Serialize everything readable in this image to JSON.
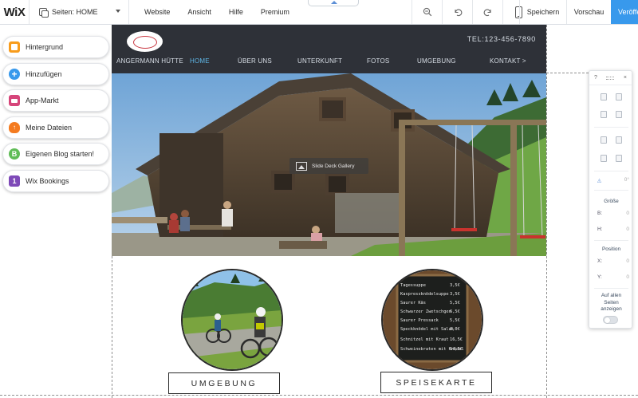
{
  "editor": {
    "logo": "WiX",
    "pages_selector": "Seiten: HOME",
    "menu": [
      "Website",
      "Ansicht",
      "Hilfe",
      "Premium"
    ],
    "save_label": "Speichern",
    "preview_label": "Vorschau",
    "publish_label": "Veröffentlichen",
    "accent_color": "#3899ec"
  },
  "left_panel": {
    "items": [
      {
        "label": "Hintergrund",
        "icon": "background-icon",
        "color": "#f89c1c"
      },
      {
        "label": "Hinzufügen",
        "icon": "add-icon",
        "color": "#3899ec"
      },
      {
        "label": "App-Markt",
        "icon": "app-market-icon",
        "color": "#d6457a"
      },
      {
        "label": "Meine Dateien",
        "icon": "cloud-upload-icon",
        "color": "#f47b20"
      },
      {
        "label": "Eigenen Blog starten!",
        "icon": "blog-icon",
        "color": "#60bc57"
      },
      {
        "label": "Wix Bookings",
        "icon": "calendar-icon",
        "color": "#7e4ab8"
      }
    ]
  },
  "site": {
    "phone": "TEL:123-456-7890",
    "nav": [
      "ANGERMANN HÜTTE",
      "HOME",
      "ÜBER UNS",
      "UNTERKUNFT",
      "FOTOS",
      "UMGEBUNG",
      "KONTAKT >"
    ],
    "active_nav": "HOME",
    "gallery_label": "Slide Deck Gallery",
    "section_buttons": [
      "UMGEBUNG",
      "SPEISEKARTE"
    ],
    "menu_board": {
      "items": [
        {
          "name": "Tagessuppe",
          "price": "3,5€"
        },
        {
          "name": "Kaspressknödelsuppe",
          "price": "3,5€"
        },
        {
          "name": "Saurer Käs",
          "price": "5,5€"
        },
        {
          "name": "Schwarzer Zwetschgen",
          "price": "6,5€"
        },
        {
          "name": "Saurer Pressack",
          "price": "5,5€"
        },
        {
          "name": "Speckknödel mit Salat",
          "price": "8,0€"
        },
        {
          "name": "Schnitzel mit Kraut",
          "price": "16,5€"
        },
        {
          "name": "Schweinebraten mit Knödel",
          "price": "14,5€"
        }
      ]
    }
  },
  "right_panel": {
    "help": "?",
    "close": "×",
    "rotation": "0°",
    "size_label": "Größe",
    "width_label": "B:",
    "width_value": "0",
    "height_label": "H:",
    "height_value": "0",
    "position_label": "Position",
    "x_label": "X:",
    "x_value": "0",
    "y_label": "Y:",
    "y_value": "0",
    "all_pages_label": "Auf allen Seiten anzeigen"
  }
}
